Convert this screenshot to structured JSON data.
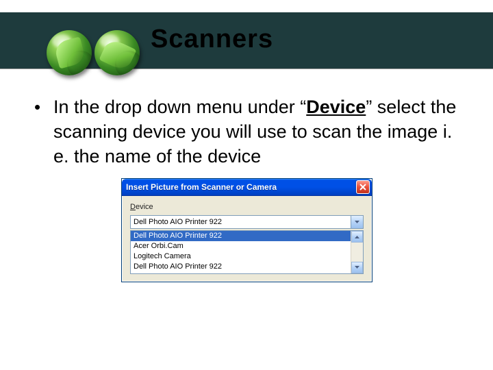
{
  "header": {
    "title": "Scanners"
  },
  "bullet": {
    "pre": "In the drop down menu under “",
    "emph": "Device",
    "post": "” select the scanning device you will use to scan the image i. e. the name of the device"
  },
  "dialog": {
    "title": "Insert Picture from Scanner or Camera",
    "device_label_u": "D",
    "device_label_rest": "evice",
    "combo_value": "Dell Photo AIO Printer 922",
    "options": [
      "Dell Photo AIO Printer 922",
      "Acer Orbi.Cam",
      "Logitech Camera",
      "Dell Photo AIO Printer 922"
    ],
    "selected_index": 0
  }
}
